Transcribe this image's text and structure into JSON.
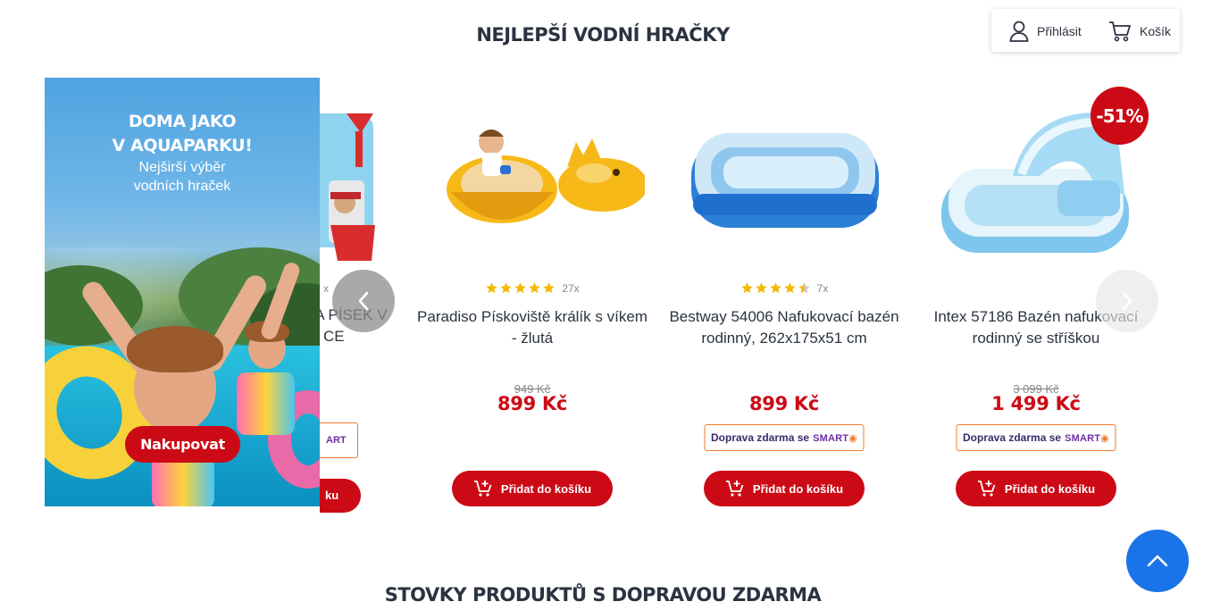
{
  "sections": {
    "title_water_toys": "NEJLEPŠÍ VODNÍ HRAČKY",
    "title_free_shipping": "STOVKY PRODUKTŮ S DOPRAVOU ZDARMA"
  },
  "header": {
    "login_label": "Přihlásit",
    "cart_label": "Košík"
  },
  "banner": {
    "heading_line1": "DOMA JAKO",
    "heading_line2": "V AQUAPARKU!",
    "sub_line1": "Nejširší výběr",
    "sub_line2": "vodních hraček",
    "button_label": "Nakupovat"
  },
  "partial_card": {
    "rating_count_fragment": "x",
    "name_line1_fragment": "NA PÍSEK V",
    "name_line2_fragment": "CE",
    "ship_fragment": "ART",
    "button_fragment": "ku"
  },
  "products": [
    {
      "name": "Paradiso Pískoviště králík s víkem - žlutá",
      "rating": 5,
      "rating_count": "27x",
      "old_price": "949 Kč",
      "price": "899 Kč",
      "free_shipping": false,
      "add_label": "Přidat do košíku"
    },
    {
      "name": "Bestway 54006 Nafukovací bazén rodinný, 262x175x51 cm",
      "rating": 4.5,
      "rating_count": "7x",
      "old_price": "",
      "price": "899 Kč",
      "free_shipping": true,
      "ship_label": "Doprava zdarma se",
      "ship_brand": "SMART",
      "add_label": "Přidat do košíku"
    },
    {
      "name": "Intex 57186 Bazén nafukovací rodinný se stříškou",
      "rating": null,
      "rating_count": "",
      "old_price": "3 099 Kč",
      "price": "1 499 Kč",
      "discount": "-51%",
      "free_shipping": true,
      "ship_label": "Doprava zdarma se",
      "ship_brand": "SMART",
      "add_label": "Přidat do košíku"
    }
  ],
  "colors": {
    "brand_red": "#cc0a16",
    "scroll_top_blue": "#1a73e8",
    "star_yellow": "#f5b800",
    "ship_border_orange": "#f07b2b"
  },
  "icons": {
    "login": "user-icon",
    "cart": "cart-icon",
    "add_to_cart": "cart-plus-icon",
    "prev": "chevron-left-icon",
    "next": "chevron-right-icon",
    "scroll_top": "chevron-up-icon"
  }
}
